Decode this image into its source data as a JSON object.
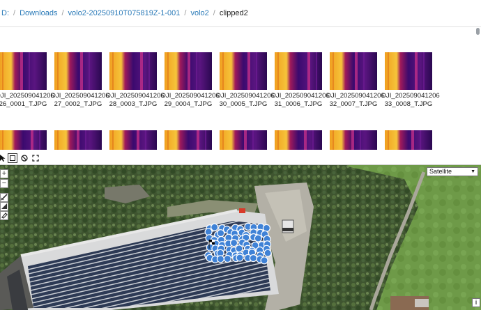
{
  "breadcrumb": {
    "items": [
      "D:",
      "Downloads",
      "volo2-20250910T075819Z-1-001",
      "volo2",
      "clipped2"
    ]
  },
  "thumbnails": [
    {
      "line1": "DJI_202509041206",
      "line2": "26_0001_T.JPG"
    },
    {
      "line1": "DJI_202509041206",
      "line2": "27_0002_T.JPG"
    },
    {
      "line1": "DJI_202509041206",
      "line2": "28_0003_T.JPG"
    },
    {
      "line1": "DJI_202509041206",
      "line2": "29_0004_T.JPG"
    },
    {
      "line1": "DJI_202509041206",
      "line2": "30_0005_T.JPG"
    },
    {
      "line1": "DJI_202509041206",
      "line2": "31_0006_T.JPG"
    },
    {
      "line1": "DJI_202509041206",
      "line2": "32_0007_T.JPG"
    },
    {
      "line1": "DJI_202509041206",
      "line2": "33_0008_T.JPG"
    }
  ],
  "toolbar": {
    "tools": [
      "pointer-tool-icon",
      "rectangle-select-icon",
      "clear-icon",
      "fullscreen-icon"
    ]
  },
  "map": {
    "layer_select": {
      "selected": "Satellite"
    },
    "zoom_in": "+",
    "zoom_out": "−",
    "info_label": "i",
    "draw_tools": [
      "draw-line-icon",
      "draw-polygon-icon",
      "eraser-icon"
    ]
  },
  "colors": {
    "link": "#2a7ab8",
    "marker": "#3f82d6",
    "thermal_hot": "#f6c43a",
    "thermal_cold": "#3b0a6e"
  }
}
